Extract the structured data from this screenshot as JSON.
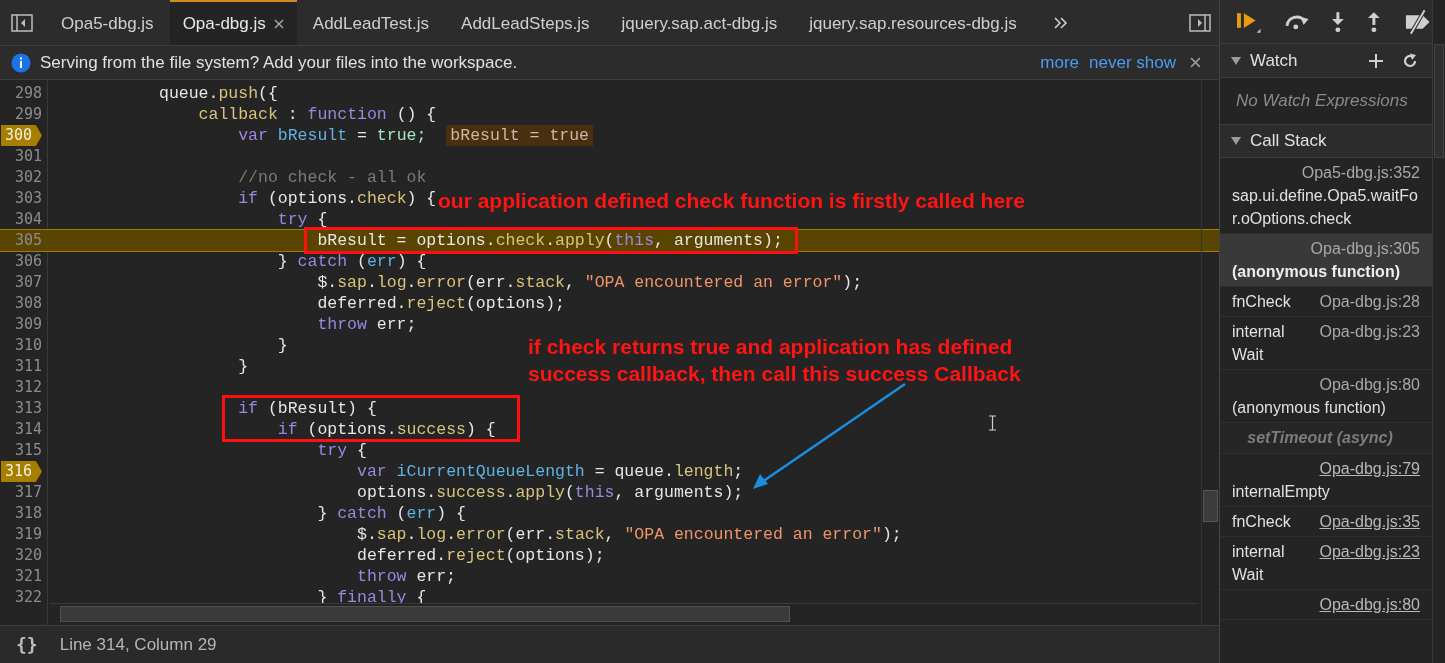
{
  "tabs": [
    {
      "label": "Opa5-dbg.js",
      "selected": false
    },
    {
      "label": "Opa-dbg.js",
      "selected": true
    },
    {
      "label": "AddLeadTest.js",
      "selected": false
    },
    {
      "label": "AddLeadSteps.js",
      "selected": false
    },
    {
      "label": "jquery.sap.act-dbg.js",
      "selected": false
    },
    {
      "label": "jquery.sap.resources-dbg.js",
      "selected": false
    }
  ],
  "info_bar": {
    "message": "Serving from the file system? Add your files into the workspace.",
    "links": [
      "more",
      "never show"
    ]
  },
  "editor": {
    "lines": [
      {
        "number": "298",
        "breakpoint": false,
        "current": false,
        "tokens": [
          {
            "text": "queue.",
            "kind": "plain"
          },
          {
            "text": "push",
            "kind": "prop"
          },
          {
            "text": "({",
            "kind": "plain"
          }
        ]
      },
      {
        "number": "299",
        "breakpoint": false,
        "current": false,
        "tokens": [
          {
            "text": "callback",
            "kind": "prop"
          },
          {
            "text": " : ",
            "kind": "plain"
          },
          {
            "text": "function",
            "kind": "kw"
          },
          {
            "text": " () {",
            "kind": "plain"
          }
        ]
      },
      {
        "number": "300",
        "breakpoint": true,
        "current": false,
        "tokens": [
          {
            "text": "var",
            "kind": "kw"
          },
          {
            "text": " bResult",
            "kind": "var"
          },
          {
            "text": " = ",
            "kind": "plain"
          },
          {
            "text": "true;",
            "kind": "bool"
          }
        ],
        "inline_value": "bResult = true"
      },
      {
        "number": "301",
        "breakpoint": false,
        "current": false
      },
      {
        "number": "302",
        "breakpoint": false,
        "current": false,
        "tokens": [
          {
            "text": "//no check - all ok",
            "kind": "comment"
          }
        ]
      },
      {
        "number": "303",
        "breakpoint": false,
        "current": false,
        "tokens": [
          {
            "text": "if",
            "kind": "kw"
          },
          {
            "text": " (options.",
            "kind": "plain"
          },
          {
            "text": "check",
            "kind": "prop"
          },
          {
            "text": ") {",
            "kind": "plain"
          }
        ]
      },
      {
        "number": "304",
        "breakpoint": false,
        "current": false,
        "tokens": [
          {
            "text": "try",
            "kind": "kw"
          },
          {
            "text": " {",
            "kind": "plain"
          }
        ]
      },
      {
        "number": "305",
        "breakpoint": false,
        "current": true,
        "tokens": [
          {
            "text": "bResult = options.",
            "kind": "plain"
          },
          {
            "text": "check",
            "kind": "prop"
          },
          {
            "text": ".",
            "kind": "plain"
          },
          {
            "text": "apply",
            "kind": "prop"
          },
          {
            "text": "(",
            "kind": "plain"
          },
          {
            "text": "this",
            "kind": "kw"
          },
          {
            "text": ", arguments);",
            "kind": "plain"
          }
        ]
      },
      {
        "number": "306",
        "breakpoint": false,
        "current": false,
        "tokens": [
          {
            "text": "} ",
            "kind": "plain"
          },
          {
            "text": "catch",
            "kind": "kw"
          },
          {
            "text": " (",
            "kind": "plain"
          },
          {
            "text": "err",
            "kind": "var"
          },
          {
            "text": ") {",
            "kind": "plain"
          }
        ]
      },
      {
        "number": "307",
        "breakpoint": false,
        "current": false,
        "tokens": [
          {
            "text": "$.",
            "kind": "plain"
          },
          {
            "text": "sap",
            "kind": "prop"
          },
          {
            "text": ".",
            "kind": "plain"
          },
          {
            "text": "log",
            "kind": "prop"
          },
          {
            "text": ".",
            "kind": "plain"
          },
          {
            "text": "error",
            "kind": "prop"
          },
          {
            "text": "(err.",
            "kind": "plain"
          },
          {
            "text": "stack",
            "kind": "prop"
          },
          {
            "text": ", ",
            "kind": "plain"
          },
          {
            "text": "\"OPA encountered an error\"",
            "kind": "str"
          },
          {
            "text": ");",
            "kind": "plain"
          }
        ]
      },
      {
        "number": "308",
        "breakpoint": false,
        "current": false,
        "tokens": [
          {
            "text": "deferred.",
            "kind": "plain"
          },
          {
            "text": "reject",
            "kind": "prop"
          },
          {
            "text": "(options);",
            "kind": "plain"
          }
        ]
      },
      {
        "number": "309",
        "breakpoint": false,
        "current": false,
        "tokens": [
          {
            "text": "throw",
            "kind": "kw"
          },
          {
            "text": " err;",
            "kind": "plain"
          }
        ]
      },
      {
        "number": "310",
        "breakpoint": false,
        "current": false,
        "tokens": [
          {
            "text": "}",
            "kind": "plain"
          }
        ]
      },
      {
        "number": "311",
        "breakpoint": false,
        "current": false,
        "tokens": [
          {
            "text": "}",
            "kind": "plain"
          }
        ]
      },
      {
        "number": "312",
        "breakpoint": false,
        "current": false
      },
      {
        "number": "313",
        "breakpoint": false,
        "current": false,
        "tokens": [
          {
            "text": "if",
            "kind": "kw"
          },
          {
            "text": " (bResult) {",
            "kind": "plain"
          }
        ]
      },
      {
        "number": "314",
        "breakpoint": false,
        "current": false,
        "tokens": [
          {
            "text": "if",
            "kind": "kw"
          },
          {
            "text": " (options.",
            "kind": "plain"
          },
          {
            "text": "success",
            "kind": "prop"
          },
          {
            "text": ") {",
            "kind": "plain"
          }
        ]
      },
      {
        "number": "315",
        "breakpoint": false,
        "current": false,
        "tokens": [
          {
            "text": "try",
            "kind": "kw"
          },
          {
            "text": " {",
            "kind": "plain"
          }
        ]
      },
      {
        "number": "316",
        "breakpoint": true,
        "current": false,
        "tokens": [
          {
            "text": "var",
            "kind": "kw"
          },
          {
            "text": " iCurrentQueueLength",
            "kind": "var"
          },
          {
            "text": " = queue.",
            "kind": "plain"
          },
          {
            "text": "length",
            "kind": "prop"
          },
          {
            "text": ";",
            "kind": "plain"
          }
        ]
      },
      {
        "number": "317",
        "breakpoint": false,
        "current": false,
        "tokens": [
          {
            "text": "options.",
            "kind": "plain"
          },
          {
            "text": "success",
            "kind": "prop"
          },
          {
            "text": ".",
            "kind": "plain"
          },
          {
            "text": "apply",
            "kind": "prop"
          },
          {
            "text": "(",
            "kind": "plain"
          },
          {
            "text": "this",
            "kind": "kw"
          },
          {
            "text": ", arguments);",
            "kind": "plain"
          }
        ]
      },
      {
        "number": "318",
        "breakpoint": false,
        "current": false,
        "tokens": [
          {
            "text": "} ",
            "kind": "plain"
          },
          {
            "text": "catch",
            "kind": "kw"
          },
          {
            "text": " (",
            "kind": "plain"
          },
          {
            "text": "err",
            "kind": "var"
          },
          {
            "text": ") {",
            "kind": "plain"
          }
        ]
      },
      {
        "number": "319",
        "breakpoint": false,
        "current": false,
        "tokens": [
          {
            "text": "$.",
            "kind": "plain"
          },
          {
            "text": "sap",
            "kind": "prop"
          },
          {
            "text": ".",
            "kind": "plain"
          },
          {
            "text": "log",
            "kind": "prop"
          },
          {
            "text": ".",
            "kind": "plain"
          },
          {
            "text": "error",
            "kind": "prop"
          },
          {
            "text": "(err.",
            "kind": "plain"
          },
          {
            "text": "stack",
            "kind": "prop"
          },
          {
            "text": ", ",
            "kind": "plain"
          },
          {
            "text": "\"OPA encountered an error\"",
            "kind": "str"
          },
          {
            "text": ");",
            "kind": "plain"
          }
        ]
      },
      {
        "number": "320",
        "breakpoint": false,
        "current": false,
        "tokens": [
          {
            "text": "deferred.",
            "kind": "plain"
          },
          {
            "text": "reject",
            "kind": "prop"
          },
          {
            "text": "(options);",
            "kind": "plain"
          }
        ]
      },
      {
        "number": "321",
        "breakpoint": false,
        "current": false,
        "tokens": [
          {
            "text": "throw",
            "kind": "kw"
          },
          {
            "text": " err;",
            "kind": "plain"
          }
        ]
      },
      {
        "number": "322",
        "breakpoint": false,
        "current": false,
        "tokens": [
          {
            "text": "} ",
            "kind": "plain"
          },
          {
            "text": "finally",
            "kind": "kw"
          },
          {
            "text": " {",
            "kind": "plain"
          }
        ]
      }
    ],
    "annotations": [
      "our application defined check function is firstly called here",
      "if check returns true and application has defined\nsuccess callback, then call this success Callback"
    ]
  },
  "status_bar": {
    "format_button": "{}",
    "position": "Line 314, Column 29"
  },
  "sidebar": {
    "watch": {
      "title": "Watch",
      "expanded": true,
      "empty": "No Watch Expressions"
    },
    "call_stack": {
      "title": "Call Stack",
      "expanded": true,
      "frames": [
        {
          "kind": "frame",
          "function": "sap.ui.define.Opa5.waitFor.oOptions.check",
          "location": "Opa5-dbg.js:352",
          "selected": false,
          "linked": false
        },
        {
          "kind": "frame",
          "function": "(anonymous function)",
          "location": "Opa-dbg.js:305",
          "selected": true,
          "linked": false
        },
        {
          "kind": "frame",
          "function": "fnCheck",
          "location": "Opa-dbg.js:28",
          "selected": false,
          "linked": false
        },
        {
          "kind": "frame",
          "function": "internalWait",
          "location": "Opa-dbg.js:23",
          "selected": false,
          "linked": false
        },
        {
          "kind": "frame",
          "function": "(anonymous function)",
          "location": "Opa-dbg.js:80",
          "selected": false,
          "linked": false
        },
        {
          "kind": "async",
          "label": "setTimeout (async)"
        },
        {
          "kind": "frame",
          "function": "internalEmpty",
          "location": "Opa-dbg.js:79",
          "selected": false,
          "linked": true
        },
        {
          "kind": "frame",
          "function": "fnCheck",
          "location": "Opa-dbg.js:35",
          "selected": false,
          "linked": true
        },
        {
          "kind": "frame",
          "function": "internalWait",
          "location": "Opa-dbg.js:23",
          "selected": false,
          "linked": true
        },
        {
          "kind": "frame",
          "location": "Opa-dbg.js:80",
          "selected": false,
          "linked": true
        }
      ]
    }
  }
}
